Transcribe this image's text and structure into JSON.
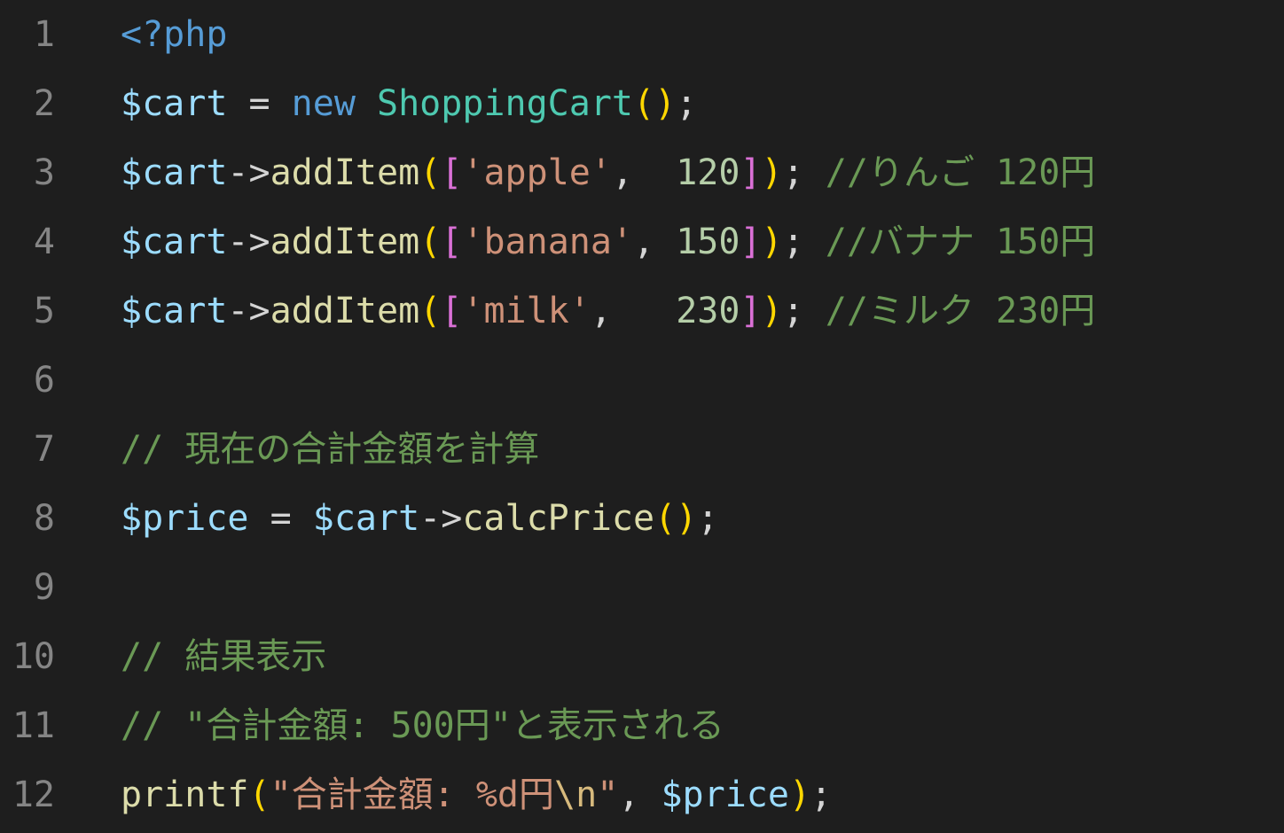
{
  "colors": {
    "background": "#1e1e1e",
    "line_number": "#858585",
    "keyword": "#569cd6",
    "variable": "#9cdcfe",
    "class": "#4ec9b0",
    "function": "#dcdcaa",
    "string": "#ce9178",
    "number": "#b5cea8",
    "comment": "#6a9955",
    "operator": "#d4d4d4",
    "bracket_yellow": "#ffd700",
    "bracket_pink": "#da70d6",
    "escape": "#d7ba7d"
  },
  "lines": [
    {
      "num": "1",
      "tokens": [
        {
          "t": "<?php",
          "c": "keyword"
        }
      ]
    },
    {
      "num": "2",
      "tokens": [
        {
          "t": "$cart",
          "c": "variable"
        },
        {
          "t": " = ",
          "c": "operator"
        },
        {
          "t": "new",
          "c": "keyword"
        },
        {
          "t": " ",
          "c": "operator"
        },
        {
          "t": "ShoppingCart",
          "c": "class"
        },
        {
          "t": "()",
          "c": "bracket_yellow"
        },
        {
          "t": ";",
          "c": "operator"
        }
      ]
    },
    {
      "num": "3",
      "tokens": [
        {
          "t": "$cart",
          "c": "variable"
        },
        {
          "t": "->",
          "c": "operator"
        },
        {
          "t": "addItem",
          "c": "function"
        },
        {
          "t": "(",
          "c": "bracket_yellow"
        },
        {
          "t": "[",
          "c": "bracket_pink"
        },
        {
          "t": "'apple'",
          "c": "string"
        },
        {
          "t": ",  ",
          "c": "operator"
        },
        {
          "t": "120",
          "c": "number"
        },
        {
          "t": "]",
          "c": "bracket_pink"
        },
        {
          "t": ")",
          "c": "bracket_yellow"
        },
        {
          "t": "; ",
          "c": "operator"
        },
        {
          "t": "//りんご 120円",
          "c": "comment"
        }
      ]
    },
    {
      "num": "4",
      "tokens": [
        {
          "t": "$cart",
          "c": "variable"
        },
        {
          "t": "->",
          "c": "operator"
        },
        {
          "t": "addItem",
          "c": "function"
        },
        {
          "t": "(",
          "c": "bracket_yellow"
        },
        {
          "t": "[",
          "c": "bracket_pink"
        },
        {
          "t": "'banana'",
          "c": "string"
        },
        {
          "t": ", ",
          "c": "operator"
        },
        {
          "t": "150",
          "c": "number"
        },
        {
          "t": "]",
          "c": "bracket_pink"
        },
        {
          "t": ")",
          "c": "bracket_yellow"
        },
        {
          "t": "; ",
          "c": "operator"
        },
        {
          "t": "//バナナ 150円",
          "c": "comment"
        }
      ]
    },
    {
      "num": "5",
      "tokens": [
        {
          "t": "$cart",
          "c": "variable"
        },
        {
          "t": "->",
          "c": "operator"
        },
        {
          "t": "addItem",
          "c": "function"
        },
        {
          "t": "(",
          "c": "bracket_yellow"
        },
        {
          "t": "[",
          "c": "bracket_pink"
        },
        {
          "t": "'milk'",
          "c": "string"
        },
        {
          "t": ",   ",
          "c": "operator"
        },
        {
          "t": "230",
          "c": "number"
        },
        {
          "t": "]",
          "c": "bracket_pink"
        },
        {
          "t": ")",
          "c": "bracket_yellow"
        },
        {
          "t": "; ",
          "c": "operator"
        },
        {
          "t": "//ミルク 230円",
          "c": "comment"
        }
      ]
    },
    {
      "num": "6",
      "tokens": []
    },
    {
      "num": "7",
      "tokens": [
        {
          "t": "// 現在の合計金額を計算",
          "c": "comment"
        }
      ]
    },
    {
      "num": "8",
      "tokens": [
        {
          "t": "$price",
          "c": "variable"
        },
        {
          "t": " = ",
          "c": "operator"
        },
        {
          "t": "$cart",
          "c": "variable"
        },
        {
          "t": "->",
          "c": "operator"
        },
        {
          "t": "calcPrice",
          "c": "function"
        },
        {
          "t": "()",
          "c": "bracket_yellow"
        },
        {
          "t": ";",
          "c": "operator"
        }
      ]
    },
    {
      "num": "9",
      "tokens": []
    },
    {
      "num": "10",
      "tokens": [
        {
          "t": "// 結果表示",
          "c": "comment"
        }
      ]
    },
    {
      "num": "11",
      "tokens": [
        {
          "t": "// \"合計金額: 500円\"と表示される",
          "c": "comment"
        }
      ]
    },
    {
      "num": "12",
      "tokens": [
        {
          "t": "printf",
          "c": "function"
        },
        {
          "t": "(",
          "c": "bracket_yellow"
        },
        {
          "t": "\"合計金額: %d円",
          "c": "string"
        },
        {
          "t": "\\n",
          "c": "escape"
        },
        {
          "t": "\"",
          "c": "string"
        },
        {
          "t": ", ",
          "c": "operator"
        },
        {
          "t": "$price",
          "c": "variable"
        },
        {
          "t": ")",
          "c": "bracket_yellow"
        },
        {
          "t": ";",
          "c": "operator"
        }
      ]
    }
  ]
}
